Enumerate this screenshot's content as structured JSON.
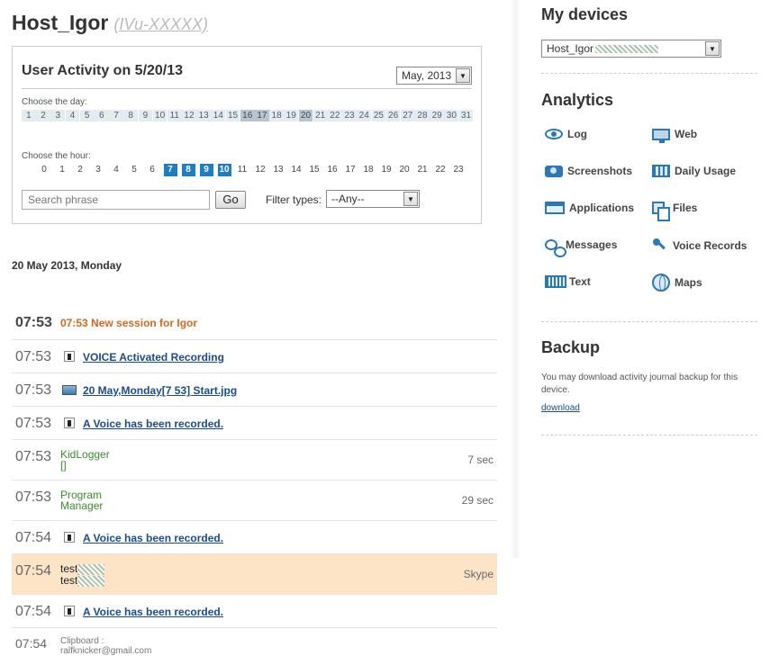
{
  "header": {
    "host_title": "Host_Igor",
    "host_subtitle": "(IVu-XXXXX)"
  },
  "activity_panel": {
    "title": "User Activity on 5/20/13",
    "month_select": "May, 2013",
    "choose_day_label": "Choose the day:",
    "days": [
      "1",
      "2",
      "3",
      "4",
      "5",
      "6",
      "7",
      "8",
      "9",
      "10",
      "11",
      "12",
      "13",
      "14",
      "15",
      "16",
      "17",
      "18",
      "19",
      "20",
      "21",
      "22",
      "23",
      "24",
      "25",
      "26",
      "27",
      "28",
      "29",
      "30",
      "31"
    ],
    "highlighted_days": [
      "16",
      "17",
      "20"
    ],
    "choose_hour_label": "Choose the hour:",
    "hours": [
      "0",
      "1",
      "2",
      "3",
      "4",
      "5",
      "6",
      "7",
      "8",
      "9",
      "10",
      "11",
      "12",
      "13",
      "14",
      "15",
      "16",
      "17",
      "18",
      "19",
      "20",
      "21",
      "22",
      "23"
    ],
    "active_hours": [
      "7",
      "8",
      "9",
      "10"
    ],
    "search_placeholder": "Search phrase",
    "go_label": "Go",
    "filter_label": "Filter types:",
    "filter_value": "--Any--"
  },
  "date_heading": "20 May 2013, Monday",
  "rows": [
    {
      "time": "07:53",
      "text": "07:53 New session for Igor",
      "kind": "session"
    },
    {
      "time": "07:53",
      "text": "VOICE Activated Recording",
      "kind": "voice"
    },
    {
      "time": "07:53",
      "text": "20 May,Monday[7 53] Start.jpg",
      "kind": "photo"
    },
    {
      "time": "07:53",
      "text": "A Voice has been recorded.",
      "kind": "voice"
    },
    {
      "time": "07:53",
      "line1": "KidLogger",
      "line2": "[]",
      "duration": "7 sec",
      "kind": "app"
    },
    {
      "time": "07:53",
      "line1": "Program",
      "line2": "Manager",
      "duration": "29 sec",
      "kind": "app"
    },
    {
      "time": "07:54",
      "text": "A Voice has been recorded.",
      "kind": "voice"
    },
    {
      "time": "07:54",
      "line1": "test",
      "line2": "test",
      "duration": "Skype",
      "kind": "chat"
    },
    {
      "time": "07:54",
      "text": "A Voice has been recorded.",
      "kind": "voice"
    },
    {
      "time": "07:54",
      "line1": "Clipboard :",
      "line2": "ralfknicker@gmail.com",
      "kind": "clipboard"
    }
  ],
  "sidebar": {
    "devices_title": "My devices",
    "device_select": "Host_Igor",
    "analytics_title": "Analytics",
    "analytics": [
      {
        "label": "Log",
        "icon": "eye-icon"
      },
      {
        "label": "Web",
        "icon": "monitor-icon"
      },
      {
        "label": "Screenshots",
        "icon": "camera-icon"
      },
      {
        "label": "Daily Usage",
        "icon": "calendar-icon"
      },
      {
        "label": "Applications",
        "icon": "window-icon"
      },
      {
        "label": "Files",
        "icon": "files-icon"
      },
      {
        "label": "Messages",
        "icon": "chat-bubbles-icon"
      },
      {
        "label": "Voice Records",
        "icon": "microphone-icon"
      },
      {
        "label": "Text",
        "icon": "keyboard-icon"
      },
      {
        "label": "Maps",
        "icon": "globe-icon"
      }
    ],
    "backup_title": "Backup",
    "backup_text": "You may download activity journal backup for this device.",
    "download_label": "download"
  },
  "colors": {
    "active_hour": "#1f7dc2",
    "session_text": "#d2691e",
    "link": "#1a4c8b",
    "app_text": "#3a8a2e",
    "highlight_row": "#fde4c7"
  }
}
